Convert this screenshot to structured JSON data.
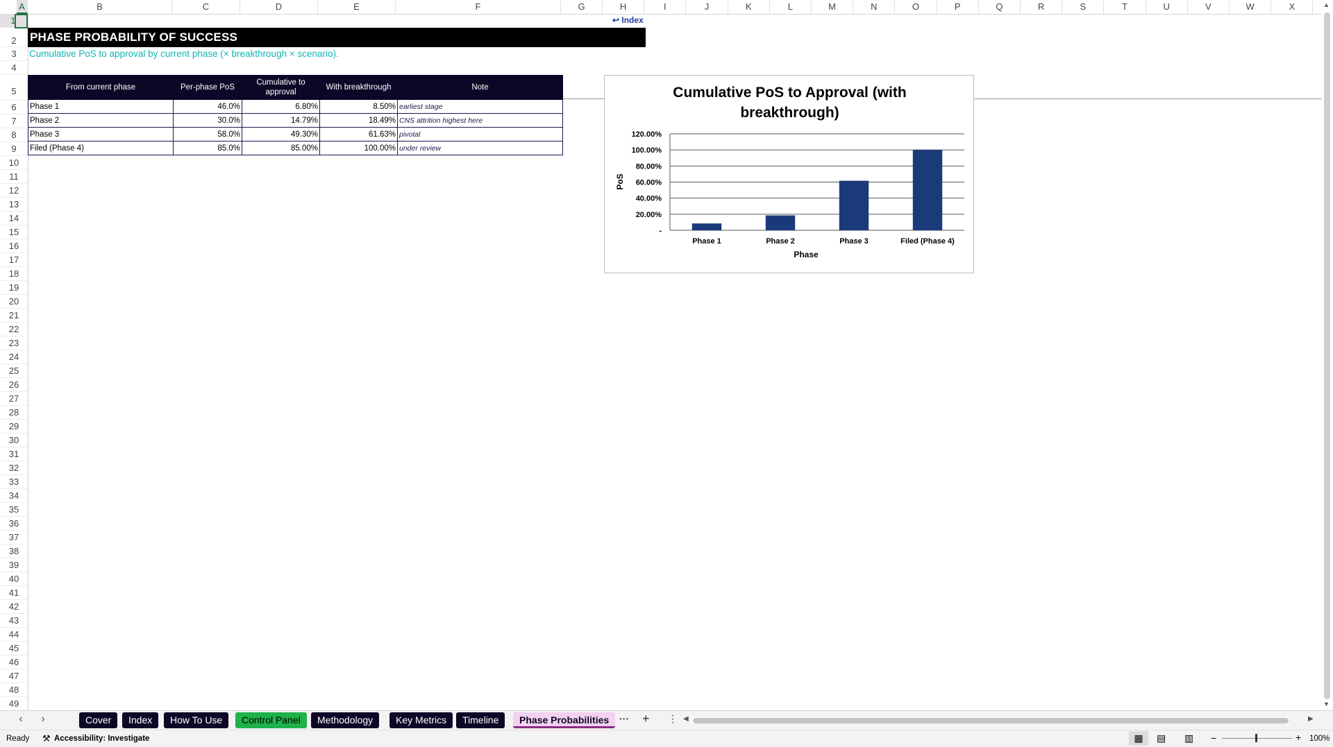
{
  "sheet": {
    "title": "PHASE PROBABILITY OF SUCCESS",
    "subtitle": "Cumulative PoS to approval by current phase (× breakthrough × scenario).",
    "index_link": "↩ Index"
  },
  "columns": [
    "A",
    "B",
    "C",
    "D",
    "E",
    "F",
    "G",
    "H",
    "I",
    "J",
    "K",
    "L",
    "M",
    "N",
    "O",
    "P",
    "Q",
    "R",
    "S",
    "T",
    "U",
    "V",
    "W",
    "X"
  ],
  "rows": [
    "1",
    "2",
    "3",
    "4",
    "5",
    "6",
    "7",
    "8",
    "9",
    "10",
    "11",
    "12",
    "13",
    "14",
    "15",
    "16",
    "17",
    "18",
    "19",
    "20",
    "21",
    "22",
    "23",
    "24",
    "25",
    "26",
    "27",
    "28",
    "29",
    "30",
    "31",
    "32",
    "33",
    "34",
    "35",
    "36",
    "37",
    "38",
    "39",
    "40",
    "41",
    "42",
    "43",
    "44",
    "45",
    "46",
    "47",
    "48",
    "49"
  ],
  "table": {
    "headers": [
      "From current phase",
      "Per-phase PoS",
      "Cumulative to approval",
      "With breakthrough",
      "Note"
    ],
    "rows": [
      {
        "phase": "Phase 1",
        "per_phase": "46.0%",
        "cumulative": "6.80%",
        "breakthrough": "8.50%",
        "note": "earliest stage"
      },
      {
        "phase": "Phase 2",
        "per_phase": "30.0%",
        "cumulative": "14.79%",
        "breakthrough": "18.49%",
        "note": "CNS attrition highest here"
      },
      {
        "phase": "Phase 3",
        "per_phase": "58.0%",
        "cumulative": "49.30%",
        "breakthrough": "61.63%",
        "note": "pivotal"
      },
      {
        "phase": "Filed (Phase 4)",
        "per_phase": "85.0%",
        "cumulative": "85.00%",
        "breakthrough": "100.00%",
        "note": "under review"
      }
    ]
  },
  "chart_data": {
    "type": "bar",
    "title": "Cumulative PoS to Approval (with breakthrough)",
    "title_line1": "Cumulative PoS to Approval (with",
    "title_line2": "breakthrough)",
    "categories": [
      "Phase 1",
      "Phase 2",
      "Phase 3",
      "Filed (Phase 4)"
    ],
    "values": [
      8.5,
      18.49,
      61.63,
      100.0
    ],
    "xlabel": "Phase",
    "ylabel": "PoS",
    "ylim": [
      0,
      120
    ],
    "yticks": [
      "-",
      "20.00%",
      "40.00%",
      "60.00%",
      "80.00%",
      "100.00%",
      "120.00%"
    ],
    "grid": true,
    "bar_color": "#1a3a7a"
  },
  "tabs": {
    "items": [
      {
        "label": "Cover",
        "style": "dark"
      },
      {
        "label": "Index",
        "style": "dark"
      },
      {
        "label": "How To Use",
        "style": "dark"
      },
      {
        "label": "Control Panel",
        "style": "green"
      },
      {
        "label": "Methodology",
        "style": "dark"
      },
      {
        "label": "Key Metrics",
        "style": "dark"
      },
      {
        "label": "Timeline",
        "style": "dark"
      },
      {
        "label": "Phase Probabilities",
        "style": "active"
      }
    ],
    "more": "···",
    "add": "+",
    "options": "⋮"
  },
  "status": {
    "ready": "Ready",
    "accessibility": "Accessibility: Investigate",
    "zoom": "100%"
  }
}
